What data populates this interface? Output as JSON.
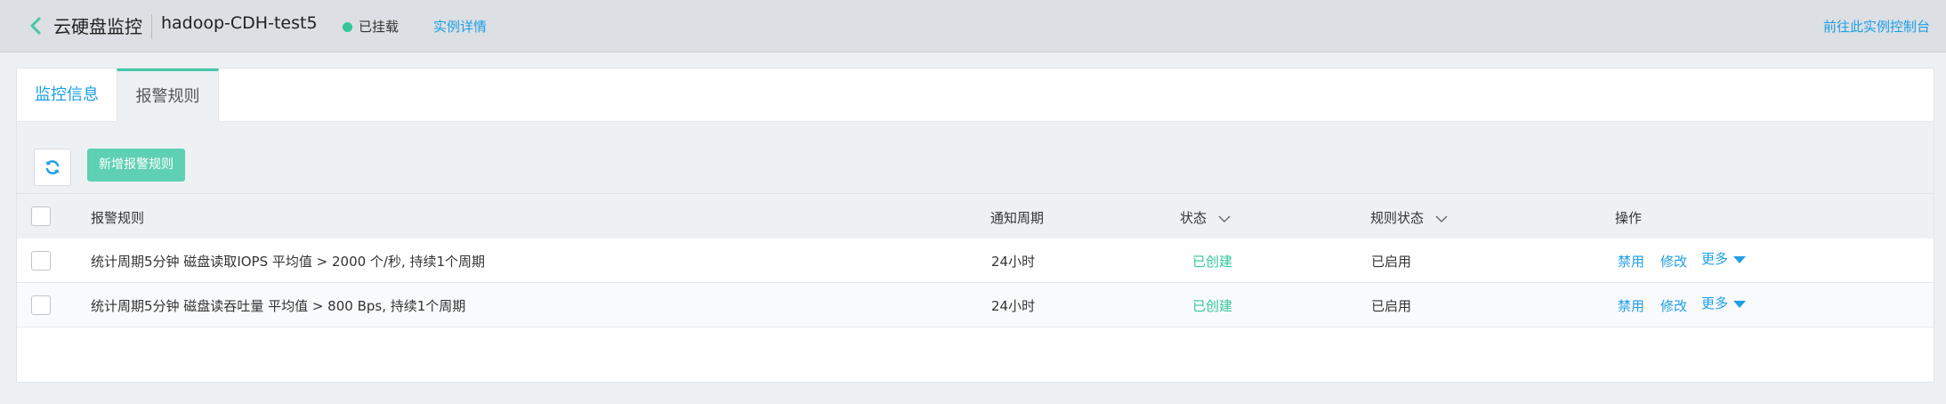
{
  "header": {
    "page_title": "云硬盘监控",
    "instance_name": "hadoop-CDH-test5",
    "status": "已挂载",
    "status_color": "#33c79a",
    "detail_link": "实例详情",
    "console_link": "前往此实例控制台"
  },
  "tabs": [
    {
      "label": "监控信息",
      "active": false
    },
    {
      "label": "报警规则",
      "active": true
    }
  ],
  "toolbar": {
    "refresh_icon": "refresh-icon",
    "add_rule_label": "新增报警规则"
  },
  "table": {
    "columns": {
      "rule": "报警规则",
      "period": "通知周期",
      "status": "状态",
      "rule_status": "规则状态",
      "actions": "操作"
    },
    "rows": [
      {
        "rule": "统计周期5分钟 磁盘读取IOPS 平均值 > 2000 个/秒, 持续1个周期",
        "period": "24小时",
        "status": "已创建",
        "rule_status": "已启用",
        "disable": "禁用",
        "edit": "修改",
        "more": "更多"
      },
      {
        "rule": "统计周期5分钟 磁盘读吞吐量 平均值 > 800 Bps, 持续1个周期",
        "period": "24小时",
        "status": "已创建",
        "rule_status": "已启用",
        "disable": "禁用",
        "edit": "修改",
        "more": "更多"
      }
    ]
  },
  "colors": {
    "accent": "#1e9fe6",
    "primary_button": "#5ed0b4",
    "tab_indicator": "#44c8a9"
  }
}
